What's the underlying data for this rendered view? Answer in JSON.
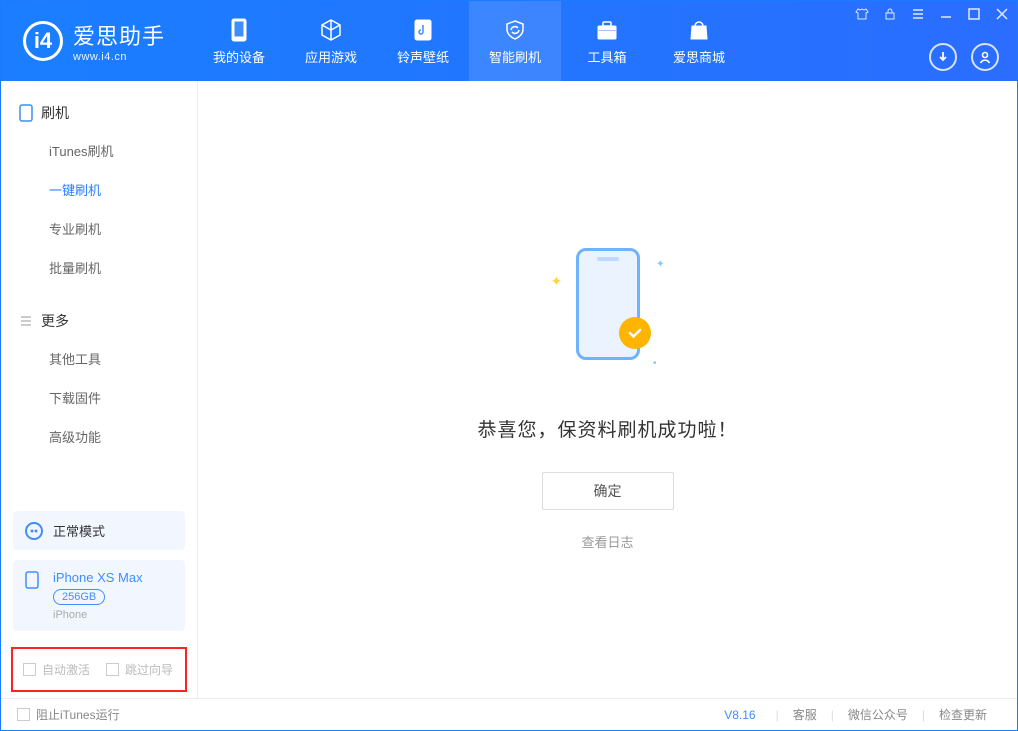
{
  "brand": {
    "name": "爱思助手",
    "url": "www.i4.cn"
  },
  "nav": {
    "items": [
      {
        "label": "我的设备"
      },
      {
        "label": "应用游戏"
      },
      {
        "label": "铃声壁纸"
      },
      {
        "label": "智能刷机"
      },
      {
        "label": "工具箱"
      },
      {
        "label": "爱思商城"
      }
    ]
  },
  "sidebar": {
    "group1_title": "刷机",
    "group1_items": [
      "iTunes刷机",
      "一键刷机",
      "专业刷机",
      "批量刷机"
    ],
    "group2_title": "更多",
    "group2_items": [
      "其他工具",
      "下载固件",
      "高级功能"
    ]
  },
  "device": {
    "mode": "正常模式",
    "name": "iPhone XS Max",
    "capacity": "256GB",
    "type": "iPhone"
  },
  "options": {
    "auto_activate": "自动激活",
    "skip_guide": "跳过向导"
  },
  "main": {
    "success_msg": "恭喜您，保资料刷机成功啦！",
    "confirm": "确定",
    "view_log": "查看日志"
  },
  "footer": {
    "block_itunes": "阻止iTunes运行",
    "version": "V8.16",
    "links": [
      "客服",
      "微信公众号",
      "检查更新"
    ]
  }
}
